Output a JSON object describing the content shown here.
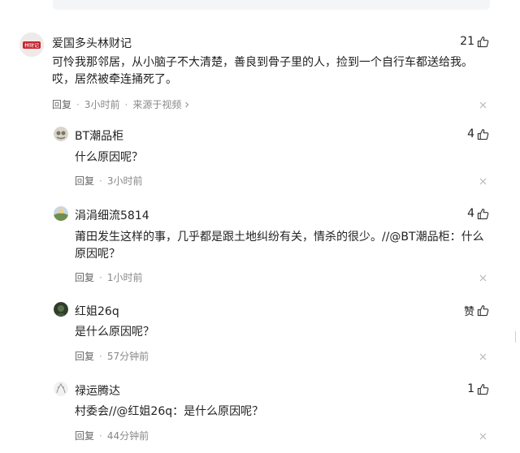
{
  "comments": [
    {
      "username": "爱国多头林财记",
      "avatar_text": "林财记",
      "likes": "21",
      "content": "可怜我那邻居，从小脑子不大清楚，善良到骨子里的人，捡到一个自行车都送给我。哎，居然被牵连捅死了。",
      "reply_label": "回复",
      "time": "3小时前",
      "source": "来源于视频"
    },
    {
      "username": "BT潮品柜",
      "likes": "4",
      "content": "什么原因呢？",
      "reply_label": "回复",
      "time": "3小时前"
    },
    {
      "username": "涓涓细流5814",
      "likes": "4",
      "content": "莆田发生这样的事，几乎都是跟土地纠纷有关，情杀的很少。//@BT潮品柜：什么原因呢？",
      "reply_label": "回复",
      "time": "1小时前"
    },
    {
      "username": "红姐26q",
      "likes": "赞",
      "content": "是什么原因呢？",
      "reply_label": "回复",
      "time": "57分钟前"
    },
    {
      "username": "禄运腾达",
      "likes": "1",
      "content": "村委会//@红姐26q：是什么原因呢？",
      "reply_label": "回复",
      "time": "44分钟前"
    }
  ],
  "colors": {
    "text": "#222222",
    "meta": "#888888",
    "avatar_red": "#c8232c"
  },
  "icons": [
    "thumbs-up-icon",
    "close-icon",
    "chevron-right-icon"
  ]
}
